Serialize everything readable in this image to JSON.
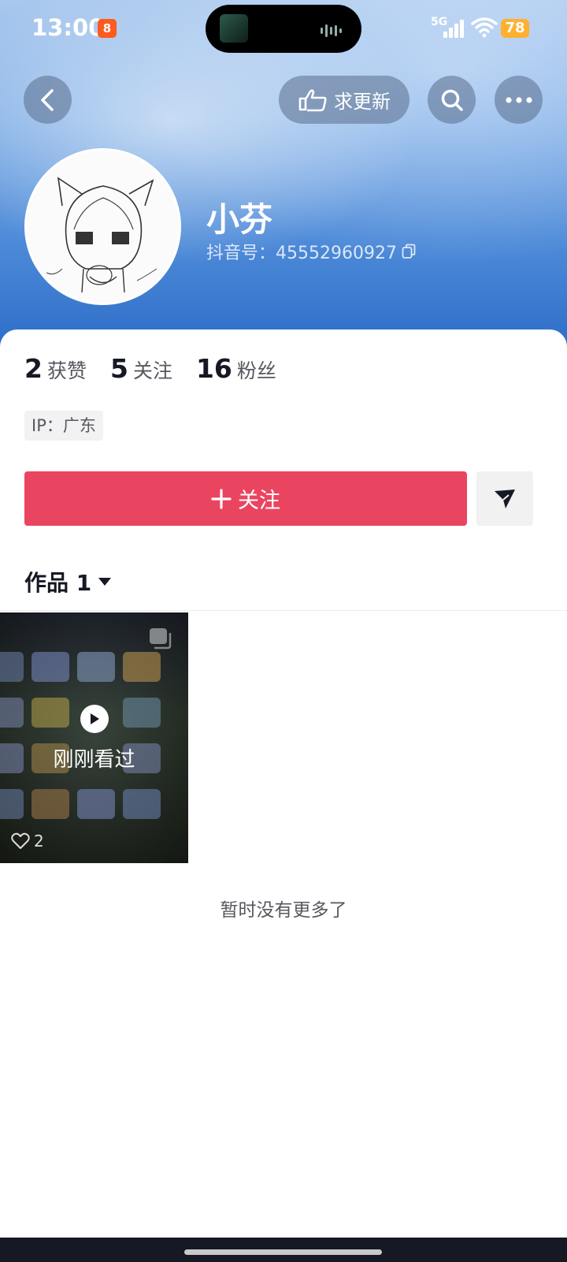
{
  "status_bar": {
    "time": "13:00",
    "app_badge": "8",
    "network": "5G",
    "battery": "78"
  },
  "nav": {
    "back_icon": "chevron-left-icon",
    "request_update_label": "求更新",
    "search_icon": "search-icon",
    "more_icon": "more-dots-icon"
  },
  "profile": {
    "name": "小芬",
    "douyin_id": "抖音号：45552960927",
    "copy_icon": "copy-icon"
  },
  "stats": [
    {
      "value": "2",
      "label": "获赞"
    },
    {
      "value": "5",
      "label": "关注"
    },
    {
      "value": "16",
      "label": "粉丝"
    }
  ],
  "ip_tag": "IP：广东",
  "actions": {
    "follow_label": "关注",
    "follow_icon": "plus-icon",
    "message_icon": "send-icon"
  },
  "works": {
    "tab_label": "作品 1",
    "items": [
      {
        "overlay": "刚刚看过",
        "likes": "2"
      }
    ],
    "end_text": "暂时没有更多了"
  },
  "colors": {
    "accent": "#ea4560",
    "battery": "#ffb02e"
  }
}
